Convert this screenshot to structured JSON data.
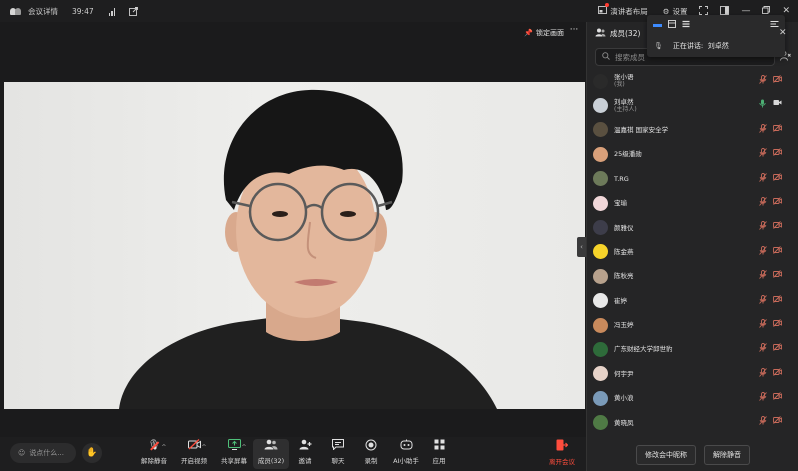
{
  "titlebar": {
    "meeting_details": "会议详情",
    "duration": "39:47",
    "layout_label": "演讲者布局",
    "settings_label": "设置",
    "window_controls": [
      "minimize-icon",
      "restore-icon",
      "close-icon"
    ]
  },
  "stage": {
    "pin_label": "锁定画面"
  },
  "toolbar": {
    "chat_placeholder": "说点什么...",
    "buttons": [
      {
        "label": "解除静音",
        "icon": "mic-muted-icon"
      },
      {
        "label": "开启视频",
        "icon": "camera-off-icon"
      },
      {
        "label": "共享屏幕",
        "icon": "share-screen-icon"
      },
      {
        "label": "成员(32)",
        "icon": "members-icon"
      },
      {
        "label": "邀请",
        "icon": "invite-icon"
      },
      {
        "label": "聊天",
        "icon": "chat-icon"
      },
      {
        "label": "录制",
        "icon": "record-icon"
      },
      {
        "label": "AI小助手",
        "icon": "ai-assistant-icon"
      },
      {
        "label": "应用",
        "icon": "apps-icon"
      }
    ],
    "leave_label": "离开会议"
  },
  "panel": {
    "title": "成员(32)",
    "search_placeholder": "搜索成员",
    "members": [
      {
        "name": "张小语",
        "sub": "(我)",
        "avatar_color": "#2a2a2a",
        "mic": "muted",
        "cam": "off"
      },
      {
        "name": "刘卓然",
        "sub": "(主持人)",
        "avatar_color": "#c9cfd6",
        "mic": "on",
        "cam": "on"
      },
      {
        "name": "温嘉祺 国家安全学",
        "sub": "",
        "avatar_color": "#5a5040",
        "mic": "muted",
        "cam": "off"
      },
      {
        "name": "25级潘勋",
        "sub": "",
        "avatar_color": "#d9a07a",
        "mic": "muted",
        "cam": "off"
      },
      {
        "name": "T.RG",
        "sub": "",
        "avatar_color": "#6d7a5a",
        "mic": "muted",
        "cam": "off"
      },
      {
        "name": "宝瑜",
        "sub": "",
        "avatar_color": "#f1d7d9",
        "mic": "muted",
        "cam": "off"
      },
      {
        "name": "颜雅仪",
        "sub": "",
        "avatar_color": "#3d3d4a",
        "mic": "muted",
        "cam": "off"
      },
      {
        "name": "陈金燕",
        "sub": "",
        "avatar_color": "#f6d32a",
        "mic": "muted",
        "cam": "off"
      },
      {
        "name": "陈秋亮",
        "sub": "",
        "avatar_color": "#b7a18c",
        "mic": "muted",
        "cam": "off"
      },
      {
        "name": "崔婷",
        "sub": "",
        "avatar_color": "#e8e8e8",
        "mic": "muted",
        "cam": "off"
      },
      {
        "name": "冯玉婷",
        "sub": "",
        "avatar_color": "#c98a5c",
        "mic": "muted",
        "cam": "off"
      },
      {
        "name": "广东财经大学邱世豹",
        "sub": "",
        "avatar_color": "#2e6b3a",
        "mic": "muted",
        "cam": "off"
      },
      {
        "name": "何宇尹",
        "sub": "",
        "avatar_color": "#e6d2c8",
        "mic": "muted",
        "cam": "off"
      },
      {
        "name": "黄小浪",
        "sub": "",
        "avatar_color": "#7a9ab8",
        "mic": "muted",
        "cam": "off"
      },
      {
        "name": "黄晓凤",
        "sub": "",
        "avatar_color": "#4f7a45",
        "mic": "muted",
        "cam": "off"
      }
    ],
    "rename_label": "修改会中昵称",
    "unmute_all_label": "解除静音"
  },
  "popup": {
    "speaking_label": "正在讲话:",
    "speaker": "刘卓然"
  },
  "colors": {
    "background": "#1b1b1c",
    "panel": "#252526",
    "accent": "#3d8bff",
    "danger": "#ff4d3d",
    "muted_icon": "#c86a5a"
  }
}
